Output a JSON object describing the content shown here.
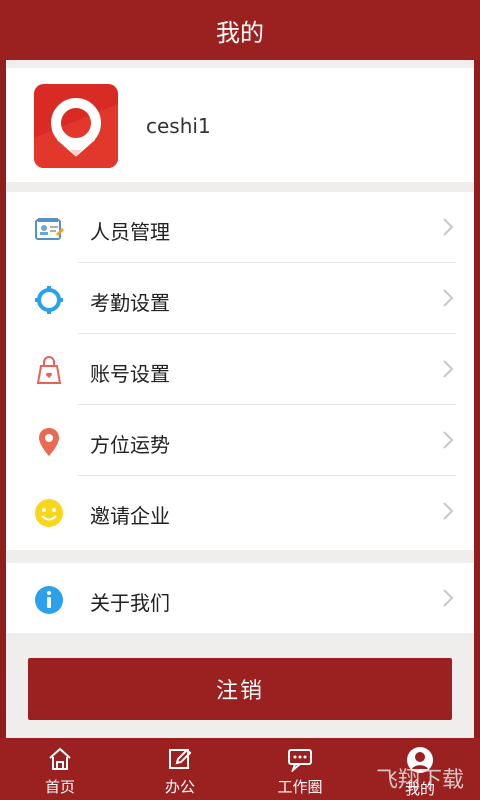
{
  "header": {
    "title": "我的"
  },
  "profile": {
    "username": "ceshi1"
  },
  "menu": {
    "items": [
      {
        "label": "人员管理",
        "icon": "staff-management-icon"
      },
      {
        "label": "考勤设置",
        "icon": "attendance-settings-icon"
      },
      {
        "label": "账号设置",
        "icon": "account-settings-icon"
      },
      {
        "label": "方位运势",
        "icon": "location-fortune-icon"
      },
      {
        "label": "邀请企业",
        "icon": "invite-company-icon"
      }
    ]
  },
  "about": {
    "label": "关于我们",
    "icon": "info-icon"
  },
  "actions": {
    "logout_label": "注销"
  },
  "tabbar": {
    "items": [
      {
        "label": "首页",
        "icon": "home-icon"
      },
      {
        "label": "办公",
        "icon": "edit-icon"
      },
      {
        "label": "工作圈",
        "icon": "chat-icon"
      },
      {
        "label": "我的",
        "icon": "user-icon"
      }
    ]
  },
  "watermark": {
    "text": "飞翔下载"
  },
  "colors": {
    "brand": "#9b2120",
    "background": "#efeeec",
    "accent_orange": "#f08a3c",
    "accent_blue": "#29a8f0",
    "accent_yellow": "#f8d61b"
  }
}
